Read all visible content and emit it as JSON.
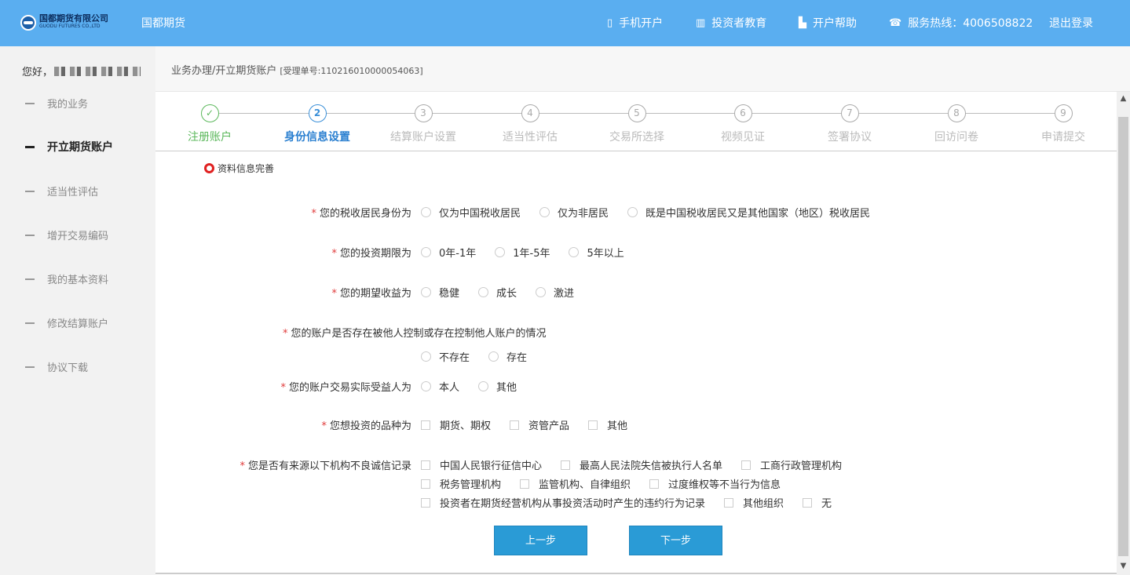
{
  "header": {
    "logo_cn": "国都期货有限公司",
    "logo_en": "GUODU FUTURES CO.,LTD",
    "brand": "国都期货",
    "nav": [
      {
        "icon": "phone-icon",
        "glyph": "▯",
        "label": "手机开户"
      },
      {
        "icon": "books-icon",
        "glyph": "▥",
        "label": "投资者教育"
      },
      {
        "icon": "help-icon",
        "glyph": "▙",
        "label": "开户帮助"
      },
      {
        "icon": "telephone-icon",
        "glyph": "☎",
        "label": "服务热线：4006508822"
      }
    ],
    "logout": "退出登录"
  },
  "sidebar": {
    "greeting": "您好，",
    "items": [
      {
        "label": "我的业务",
        "active": false
      },
      {
        "label": "开立期货账户",
        "active": true
      },
      {
        "label": "适当性评估",
        "active": false
      },
      {
        "label": "增开交易编码",
        "active": false
      },
      {
        "label": "我的基本资料",
        "active": false
      },
      {
        "label": "修改结算账户",
        "active": false
      },
      {
        "label": "协议下载",
        "active": false
      }
    ]
  },
  "breadcrumb": {
    "path": "业务办理/开立期货账户",
    "ticket": "[受理单号:110216010000054063]"
  },
  "steps": [
    {
      "num": "✓",
      "label": "注册账户",
      "state": "done"
    },
    {
      "num": "2",
      "label": "身份信息设置",
      "state": "current"
    },
    {
      "num": "3",
      "label": "结算账户设置",
      "state": "todo"
    },
    {
      "num": "4",
      "label": "适当性评估",
      "state": "todo"
    },
    {
      "num": "5",
      "label": "交易所选择",
      "state": "todo"
    },
    {
      "num": "6",
      "label": "视频见证",
      "state": "todo"
    },
    {
      "num": "7",
      "label": "签署协议",
      "state": "todo"
    },
    {
      "num": "8",
      "label": "回访问卷",
      "state": "todo"
    },
    {
      "num": "9",
      "label": "申请提交",
      "state": "todo"
    }
  ],
  "section_title": "资料信息完善",
  "questions": {
    "tax": {
      "label": "您的税收居民身份为",
      "options": [
        "仅为中国税收居民",
        "仅为非居民",
        "既是中国税收居民又是其他国家（地区）税收居民"
      ]
    },
    "period": {
      "label": "您的投资期限为",
      "options": [
        "0年-1年",
        "1年-5年",
        "5年以上"
      ]
    },
    "return": {
      "label": "您的期望收益为",
      "options": [
        "稳健",
        "成长",
        "激进"
      ]
    },
    "control": {
      "label": "您的账户是否存在被他人控制或存在控制他人账户的情况",
      "options": [
        "不存在",
        "存在"
      ]
    },
    "beneficiary": {
      "label": "您的账户交易实际受益人为",
      "options": [
        "本人",
        "其他"
      ]
    },
    "varieties": {
      "label": "您想投资的品种为",
      "options": [
        "期货、期权",
        "资管产品",
        "其他"
      ]
    },
    "credit": {
      "label": "您是否有来源以下机构不良诚信记录",
      "row1": [
        "中国人民银行征信中心",
        "最高人民法院失信被执行人名单",
        "工商行政管理机构"
      ],
      "row2": [
        "税务管理机构",
        "监管机构、自律组织",
        "过度维权等不当行为信息"
      ],
      "row3": [
        "投资者在期货经营机构从事投资活动时产生的违约行为记录",
        "其他组织",
        "无"
      ]
    }
  },
  "buttons": {
    "prev": "上一步",
    "next": "下一步"
  },
  "colors": {
    "topbar": "#5aaef0",
    "accent": "#2a9bd6",
    "done": "#5cb85c",
    "current": "#2a7fd0",
    "required": "#e03a3a"
  }
}
